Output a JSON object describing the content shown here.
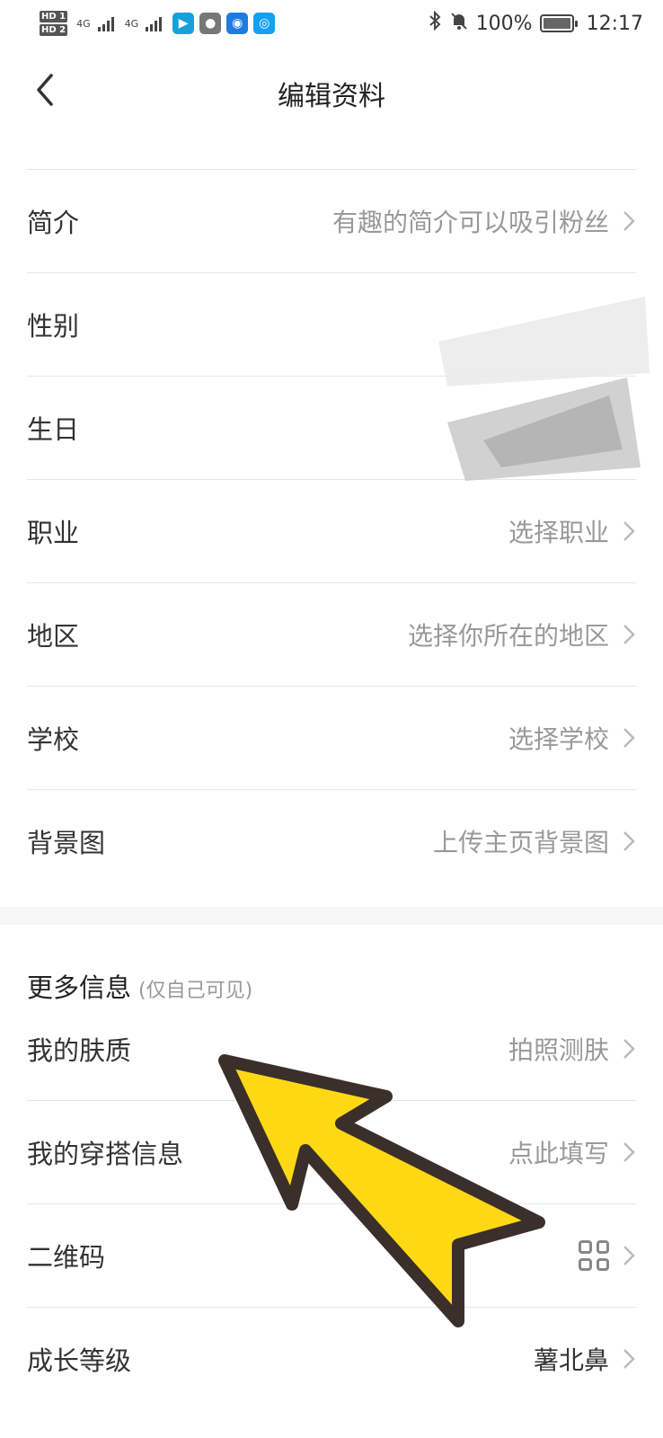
{
  "status_bar": {
    "hd1": "HD 1",
    "hd2": "HD 2",
    "sig1": "4G",
    "sig2": "4G",
    "battery": "100%",
    "time": "12:17",
    "icons": [
      "bluetooth-icon",
      "bell-muted-icon",
      "battery-icon",
      "wechat-icon",
      "chat-icon",
      "bulb-icon",
      "search-app-icon"
    ]
  },
  "header": {
    "title": "编辑资料",
    "back_icon": "chevron-left-icon"
  },
  "profile_rows": [
    {
      "label": "简介",
      "value": "有趣的简介可以吸引粉丝"
    },
    {
      "label": "性别",
      "value": ""
    },
    {
      "label": "生日",
      "value": ""
    },
    {
      "label": "职业",
      "value": "选择职业"
    },
    {
      "label": "地区",
      "value": "选择你所在的地区"
    },
    {
      "label": "学校",
      "value": "选择学校"
    },
    {
      "label": "背景图",
      "value": "上传主页背景图"
    }
  ],
  "more_info": {
    "title": "更多信息",
    "subtitle": "(仅自己可见)",
    "rows": [
      {
        "label": "我的肤质",
        "value": "拍照测肤"
      },
      {
        "label": "我的穿搭信息",
        "value": "点此填写"
      },
      {
        "label": "二维码",
        "value": ""
      },
      {
        "label": "成长等级",
        "value": "薯北鼻"
      }
    ]
  },
  "colors": {
    "arrow_fill": "#FFD814",
    "arrow_stroke": "#3a2f2a",
    "divider": "#e6e6e6",
    "muted_text": "#999999"
  }
}
